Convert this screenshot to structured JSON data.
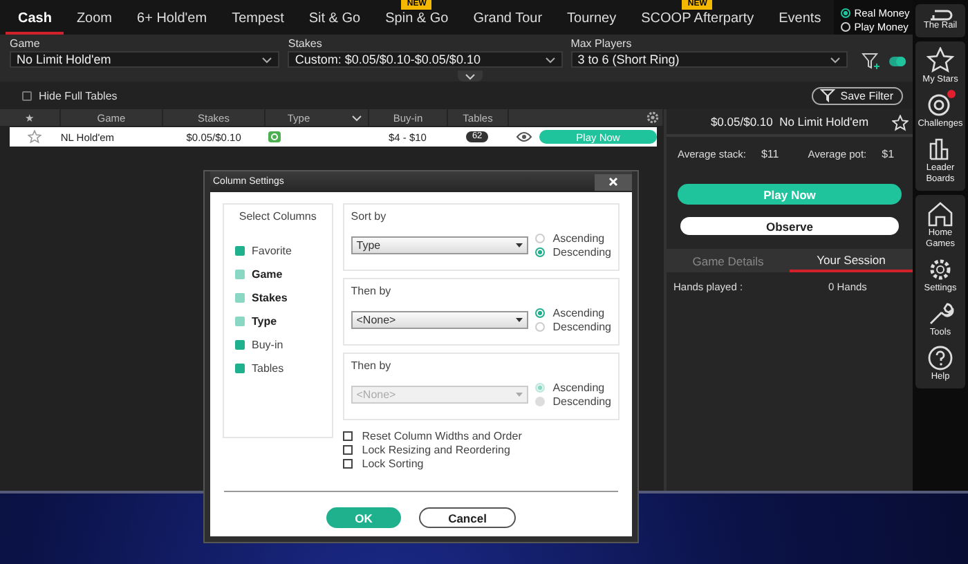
{
  "tabs": [
    {
      "label": "Cash",
      "selected": true
    },
    {
      "label": "Zoom",
      "selected": false
    },
    {
      "label": "6+ Hold'em",
      "selected": false
    },
    {
      "label": "Tempest",
      "selected": false
    },
    {
      "label": "Sit & Go",
      "selected": false
    },
    {
      "label": "Spin & Go",
      "selected": false,
      "badge": "NEW"
    },
    {
      "label": "Grand Tour",
      "selected": false
    },
    {
      "label": "Tourney",
      "selected": false
    },
    {
      "label": "SCOOP Afterparty",
      "selected": false,
      "badge": "NEW"
    },
    {
      "label": "Events",
      "selected": false
    }
  ],
  "money_modes": [
    {
      "label": "Real Money",
      "selected": true
    },
    {
      "label": "Play Money",
      "selected": false
    }
  ],
  "filters": [
    {
      "label": "Game",
      "value": "No Limit Hold'em"
    },
    {
      "label": "Stakes",
      "value": "Custom: $0.05/$0.10-$0.05/$0.10"
    },
    {
      "label": "Max Players",
      "value": "3 to 6 (Short Ring)"
    }
  ],
  "filter_toggle": {
    "on": true
  },
  "hide_full_tables": {
    "label": "Hide Full Tables",
    "checked": false
  },
  "save_filter": "Save Filter",
  "table": {
    "columns": [
      "★",
      "Game",
      "Stakes",
      "Type",
      "Buy-in",
      "Tables"
    ],
    "rows": [
      {
        "favorite": false,
        "selected": true,
        "game": "NL Hold'em",
        "stakes": "$0.05/$0.10",
        "buyin": "$4 - $10",
        "tables": "62",
        "action": "Play Now"
      }
    ]
  },
  "details": {
    "title": "$0.05/$0.10  No Limit Hold'em",
    "favorite": false,
    "stats": [
      {
        "label": "Average stack:",
        "value": "$11"
      },
      {
        "label": "Average pot:",
        "value": "$1"
      }
    ],
    "play": "Play Now",
    "observe": "Observe",
    "tabs": [
      {
        "label": "Game Details",
        "selected": false
      },
      {
        "label": "Your Session",
        "selected": true
      }
    ],
    "session": [
      {
        "label": "Hands played :",
        "value": "0 Hands"
      }
    ]
  },
  "rail": [
    {
      "items": [
        {
          "kind": "rail",
          "label": "The Rail"
        }
      ]
    },
    {
      "items": [
        {
          "kind": "star",
          "label": "My Stars"
        },
        {
          "kind": "target",
          "label": "Challenges",
          "alert": true
        },
        {
          "kind": "bars",
          "label": "Leader Boards"
        }
      ]
    },
    {
      "items": [
        {
          "kind": "home",
          "label": "Home Games"
        },
        {
          "kind": "gear",
          "label": "Settings"
        },
        {
          "kind": "wrench",
          "label": "Tools"
        },
        {
          "kind": "help",
          "label": "Help"
        }
      ]
    }
  ],
  "dialog": {
    "title": "Column Settings",
    "columns_heading": "Select Columns",
    "columns": [
      {
        "label": "Favorite",
        "checked": true,
        "locked": false
      },
      {
        "label": "Game",
        "checked": true,
        "locked": true
      },
      {
        "label": "Stakes",
        "checked": true,
        "locked": true
      },
      {
        "label": "Type",
        "checked": true,
        "locked": true
      },
      {
        "label": "Buy-in",
        "checked": true,
        "locked": false
      },
      {
        "label": "Tables",
        "checked": true,
        "locked": false
      }
    ],
    "sorts": [
      {
        "label": "Sort by",
        "value": "Type",
        "disabled": false,
        "orders": [
          {
            "label": "Ascending",
            "selected": false
          },
          {
            "label": "Descending",
            "selected": true
          }
        ]
      },
      {
        "label": "Then by",
        "value": "<None>",
        "disabled": false,
        "orders": [
          {
            "label": "Ascending",
            "selected": true
          },
          {
            "label": "Descending",
            "selected": false
          }
        ]
      },
      {
        "label": "Then by",
        "value": "<None>",
        "disabled": true,
        "orders": [
          {
            "label": "Ascending",
            "selected": true
          },
          {
            "label": "Descending",
            "selected": false
          }
        ]
      }
    ],
    "options": [
      {
        "label": "Reset Column Widths and Order",
        "checked": false
      },
      {
        "label": "Lock Resizing and Reordering",
        "checked": false
      },
      {
        "label": "Lock Sorting",
        "checked": false
      }
    ],
    "ok": "OK",
    "cancel": "Cancel"
  }
}
